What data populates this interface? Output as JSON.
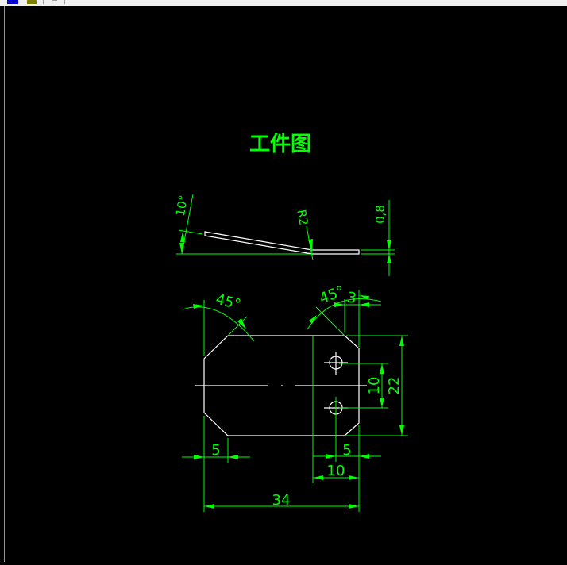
{
  "title": "工件图",
  "dimensions": {
    "angle_side": "10°",
    "radius": "R2",
    "thickness": "0,8",
    "chamfer_angle_left": "45°",
    "chamfer_angle_right": "45°",
    "chamfer_size": "3",
    "hole_spacing": "10",
    "height": "22",
    "left_offset": "5",
    "right_offset": "5",
    "bend_width": "10",
    "total_length": "34"
  },
  "colors": {
    "dimension": "#00ff00",
    "geometry": "#ffffff",
    "background": "#000000"
  }
}
